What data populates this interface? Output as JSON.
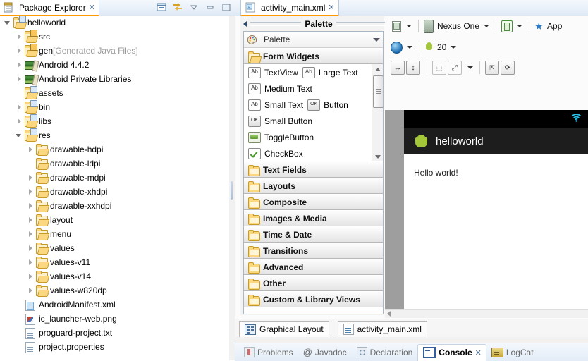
{
  "package_explorer": {
    "tab_label": "Package Explorer",
    "close_glyph": "✕",
    "toolbar": [
      {
        "name": "collapse-all-icon",
        "title": "Collapse All"
      },
      {
        "name": "link-with-editor-icon",
        "title": "Link with Editor"
      },
      {
        "name": "view-menu-icon",
        "title": "View Menu"
      },
      {
        "name": "minimize-icon",
        "title": "Minimize"
      },
      {
        "name": "maximize-icon",
        "title": "Maximize"
      }
    ],
    "tree": [
      {
        "label": "helloworld",
        "suffix": "",
        "indent": 0,
        "twist": "expanded",
        "icon": "project-folder"
      },
      {
        "label": "src",
        "suffix": "",
        "indent": 1,
        "twist": "collapsed",
        "icon": "source-folder"
      },
      {
        "label": "gen",
        "suffix": "[Generated Java Files]",
        "indent": 1,
        "twist": "collapsed",
        "icon": "source-folder"
      },
      {
        "label": "Android 4.4.2",
        "suffix": "",
        "indent": 1,
        "twist": "collapsed",
        "icon": "library"
      },
      {
        "label": "Android Private Libraries",
        "suffix": "",
        "indent": 1,
        "twist": "collapsed",
        "icon": "library"
      },
      {
        "label": "assets",
        "suffix": "",
        "indent": 1,
        "twist": "none",
        "icon": "project-folder"
      },
      {
        "label": "bin",
        "suffix": "",
        "indent": 1,
        "twist": "collapsed",
        "icon": "project-folder"
      },
      {
        "label": "libs",
        "suffix": "",
        "indent": 1,
        "twist": "collapsed",
        "icon": "project-folder"
      },
      {
        "label": "res",
        "suffix": "",
        "indent": 1,
        "twist": "expanded",
        "icon": "project-folder"
      },
      {
        "label": "drawable-hdpi",
        "suffix": "",
        "indent": 2,
        "twist": "collapsed",
        "icon": "folder"
      },
      {
        "label": "drawable-ldpi",
        "suffix": "",
        "indent": 2,
        "twist": "none",
        "icon": "folder"
      },
      {
        "label": "drawable-mdpi",
        "suffix": "",
        "indent": 2,
        "twist": "collapsed",
        "icon": "folder"
      },
      {
        "label": "drawable-xhdpi",
        "suffix": "",
        "indent": 2,
        "twist": "collapsed",
        "icon": "folder"
      },
      {
        "label": "drawable-xxhdpi",
        "suffix": "",
        "indent": 2,
        "twist": "collapsed",
        "icon": "folder"
      },
      {
        "label": "layout",
        "suffix": "",
        "indent": 2,
        "twist": "collapsed",
        "icon": "folder"
      },
      {
        "label": "menu",
        "suffix": "",
        "indent": 2,
        "twist": "collapsed",
        "icon": "folder"
      },
      {
        "label": "values",
        "suffix": "",
        "indent": 2,
        "twist": "collapsed",
        "icon": "folder"
      },
      {
        "label": "values-v11",
        "suffix": "",
        "indent": 2,
        "twist": "collapsed",
        "icon": "folder"
      },
      {
        "label": "values-v14",
        "suffix": "",
        "indent": 2,
        "twist": "collapsed",
        "icon": "folder"
      },
      {
        "label": "values-w820dp",
        "suffix": "",
        "indent": 2,
        "twist": "collapsed",
        "icon": "folder"
      },
      {
        "label": "AndroidManifest.xml",
        "suffix": "",
        "indent": 1,
        "twist": "none",
        "icon": "xml-file"
      },
      {
        "label": "ic_launcher-web.png",
        "suffix": "",
        "indent": 1,
        "twist": "none",
        "icon": "png-file"
      },
      {
        "label": "proguard-project.txt",
        "suffix": "",
        "indent": 1,
        "twist": "none",
        "icon": "text-file"
      },
      {
        "label": "project.properties",
        "suffix": "",
        "indent": 1,
        "twist": "none",
        "icon": "text-file"
      }
    ]
  },
  "editor": {
    "tab_label": "activity_main.xml",
    "close_glyph": "✕",
    "palette": {
      "header_title": "Palette",
      "topbar_label": "Palette",
      "category_open": "Form Widgets",
      "items": [
        [
          {
            "label": "TextView",
            "icon": "ab-icon"
          },
          {
            "label": "Large Text",
            "icon": "ab-icon"
          }
        ],
        [
          {
            "label": "Medium Text",
            "icon": "ab-icon"
          }
        ],
        [
          {
            "label": "Small Text",
            "icon": "ab-icon"
          },
          {
            "label": "Button",
            "icon": "ok-icon"
          }
        ],
        [
          {
            "label": "Small Button",
            "icon": "ok-icon"
          }
        ],
        [
          {
            "label": "ToggleButton",
            "icon": "toggle-icon"
          }
        ],
        [
          {
            "label": "CheckBox",
            "icon": "checkbox-icon"
          }
        ]
      ],
      "categories": [
        "Text Fields",
        "Layouts",
        "Composite",
        "Images & Media",
        "Time & Date",
        "Transitions",
        "Advanced",
        "Other",
        "Custom & Library Views"
      ]
    },
    "config_toolbar": {
      "row1": {
        "config_button": "config-icon",
        "device": "Nexus One",
        "orientation_icon": "orientation-icon",
        "theme": "App"
      },
      "row2": {
        "locale_icon": "globe-icon",
        "api_level": "20"
      },
      "row3": {
        "buttons": [
          "fit-width",
          "fit-height",
          "show-outline",
          "distribute",
          "zoom-options",
          "include-in",
          "refresh"
        ]
      }
    },
    "preview": {
      "app_title": "helloworld",
      "content_text": "Hello world!",
      "status_icons": [
        "wifi-icon"
      ]
    },
    "bottom_tabs": [
      {
        "label": "Graphical Layout",
        "icon": "graphical-layout-icon",
        "active": true
      },
      {
        "label": "activity_main.xml",
        "icon": "xml-source-icon",
        "active": false
      }
    ]
  },
  "bottom_view": {
    "tabs": [
      {
        "label": "Problems",
        "icon": "problems-icon",
        "active": false,
        "closable": false
      },
      {
        "label": "Javadoc",
        "icon": "javadoc-icon",
        "active": false,
        "closable": false
      },
      {
        "label": "Declaration",
        "icon": "declaration-icon",
        "active": false,
        "closable": false
      },
      {
        "label": "Console",
        "icon": "console-icon",
        "active": true,
        "closable": true
      },
      {
        "label": "LogCat",
        "icon": "logcat-icon",
        "active": false,
        "closable": false
      }
    ],
    "close_glyph": "✕"
  },
  "colors": {
    "tab_active_underline": "#ff9a00",
    "tab_bar_bg": "#e9f0f9",
    "android_green": "#a4c639",
    "preview_action_bar": "#1d1d1d",
    "preview_status_bar": "#000000"
  }
}
